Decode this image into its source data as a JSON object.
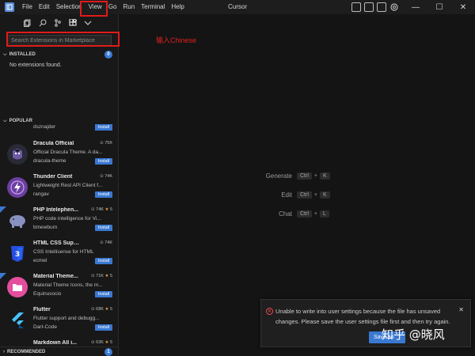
{
  "window": {
    "title": "Cursor",
    "menu": [
      "File",
      "Edit",
      "Selection",
      "View",
      "Go",
      "Run",
      "Terminal",
      "Help"
    ],
    "controls": {
      "minimize": "—",
      "maximize": "☐",
      "close": "✕"
    }
  },
  "annotation": {
    "text": "输入Chinese",
    "color": "#e01b1b"
  },
  "sidebar": {
    "search_placeholder": "Search Extensions in Marketplace",
    "installed": {
      "header": "INSTALLED",
      "count": "0",
      "empty_text": "No extensions found."
    },
    "popular": {
      "header": "POPULAR",
      "partial_top": {
        "publisher": "dsznajder",
        "install": "Install"
      },
      "items": [
        {
          "name": "Dracula Official",
          "stats": "75K",
          "rating": "",
          "desc": "Official Dracula Theme. A da...",
          "publisher": "dracula-theme",
          "install": "Install",
          "icon": "dracula-icon",
          "flag": false
        },
        {
          "name": "Thunder Client",
          "stats": "74K",
          "rating": "",
          "desc": "Lightweight Rest API Client f...",
          "publisher": "rangav",
          "install": "Install",
          "icon": "thunder-icon",
          "flag": false
        },
        {
          "name": "PHP Intelephen...",
          "stats": "74K",
          "rating": "5",
          "desc": "PHP code intelligence for Vi...",
          "publisher": "bmewburn",
          "install": "Install",
          "icon": "php-elephant-icon",
          "flag": true
        },
        {
          "name": "HTML CSS Support",
          "stats": "74K",
          "rating": "",
          "desc": "CSS Intellisense for HTML",
          "publisher": "ecmel",
          "install": "Install",
          "icon": "css3-icon",
          "flag": false
        },
        {
          "name": "Material Theme...",
          "stats": "71K",
          "rating": "5",
          "desc": "Material Theme Icons, the m...",
          "publisher": "Equinusocio",
          "install": "Install",
          "icon": "material-folder-icon",
          "flag": true
        },
        {
          "name": "Flutter",
          "stats": "68K",
          "rating": "5",
          "desc": "Flutter support and debugg...",
          "publisher": "Dart-Code",
          "install": "Install",
          "icon": "flutter-icon",
          "flag": false
        },
        {
          "name": "Markdown All i...",
          "stats": "63K",
          "rating": "5",
          "desc": "",
          "publisher": "",
          "install": "",
          "icon": "markdown-icon",
          "flag": false
        }
      ]
    },
    "recommended": {
      "header": "RECOMMENDED",
      "count": "1"
    }
  },
  "editor": {
    "shortcuts": [
      {
        "label": "Generate",
        "mod": "Ctrl",
        "key": "K"
      },
      {
        "label": "Edit",
        "mod": "Ctrl",
        "key": "K"
      },
      {
        "label": "Chat",
        "mod": "Ctrl",
        "key": "L"
      }
    ]
  },
  "notification": {
    "message": "Unable to write into user settings because the file has unsaved changes. Please save the user settings file first and then try again.",
    "button": "Save an"
  },
  "watermark": "知乎 @晓风",
  "colors": {
    "accent": "#3a78d1",
    "annotation": "#e01b1b",
    "background": "#141414",
    "sidebar": "#181818",
    "star": "#e8a33a"
  }
}
